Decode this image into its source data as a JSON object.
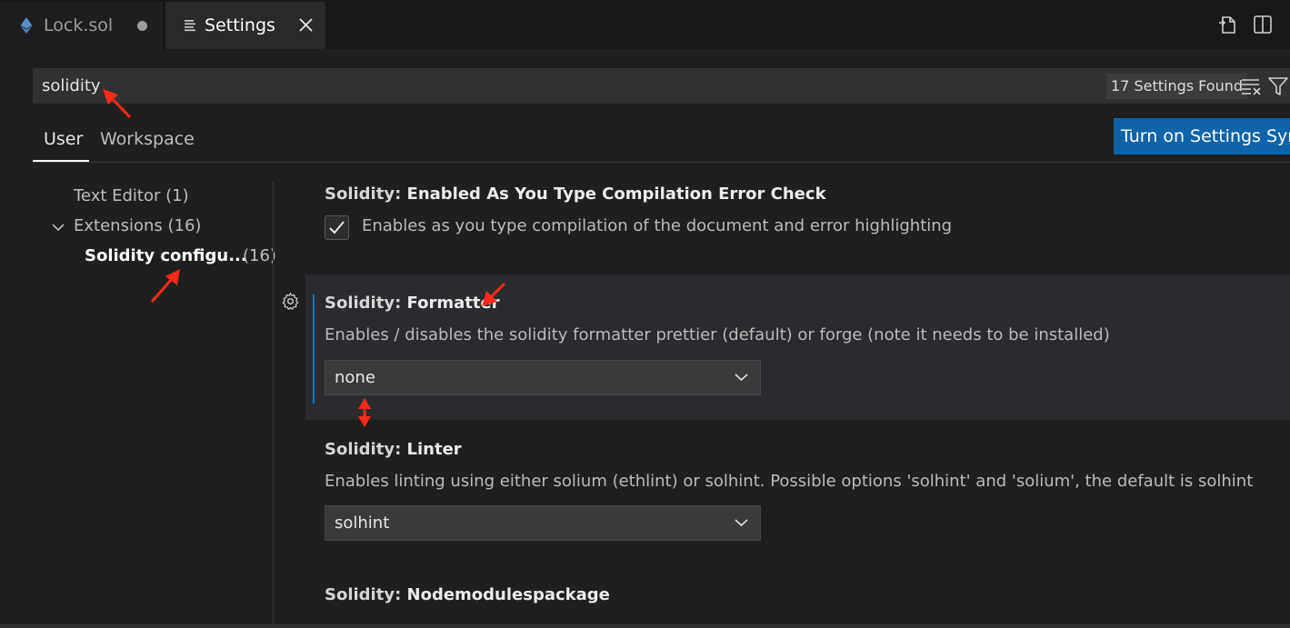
{
  "tabs": [
    {
      "label": "Lock.sol",
      "icon": "ethereum-icon",
      "state": "modified"
    },
    {
      "label": "Settings",
      "icon": "settings-file-icon",
      "state": "active"
    }
  ],
  "editor_actions": [
    "open-settings-json-icon",
    "split-editor-icon"
  ],
  "search": {
    "value": "solidity",
    "results_badge": "17 Settings Found"
  },
  "scope_tabs": [
    {
      "label": "User",
      "selected": true
    },
    {
      "label": "Workspace",
      "selected": false
    }
  ],
  "sync_button": "Turn on Settings Sync",
  "toc": {
    "text_editor": "Text Editor (1)",
    "extensions": "Extensions (16)",
    "solidity_label": "Solidity configu...",
    "solidity_count": "(16)"
  },
  "settings": [
    {
      "category": "Solidity: ",
      "key": "Enabled As You Type Compilation Error Check",
      "description": "Enables as you type compilation of the document and error highlighting",
      "checked": true
    },
    {
      "category": "Solidity: ",
      "key": "Formatter",
      "description": "Enables / disables the solidity formatter prettier (default) or forge (note it needs to be installed)",
      "value": "none"
    },
    {
      "category": "Solidity: ",
      "key": "Linter",
      "description": "Enables linting using either solium (ethlint) or solhint. Possible options 'solhint' and 'solium', the default is solhint",
      "value": "solhint"
    },
    {
      "category": "Solidity: ",
      "key": "Nodemodulespackage",
      "description": ""
    }
  ],
  "colors": {
    "accent": "#0e63a9",
    "modified_indicator": "#0a7aca",
    "annotation": "#ff2a1a",
    "background": "#1f1f1f"
  }
}
